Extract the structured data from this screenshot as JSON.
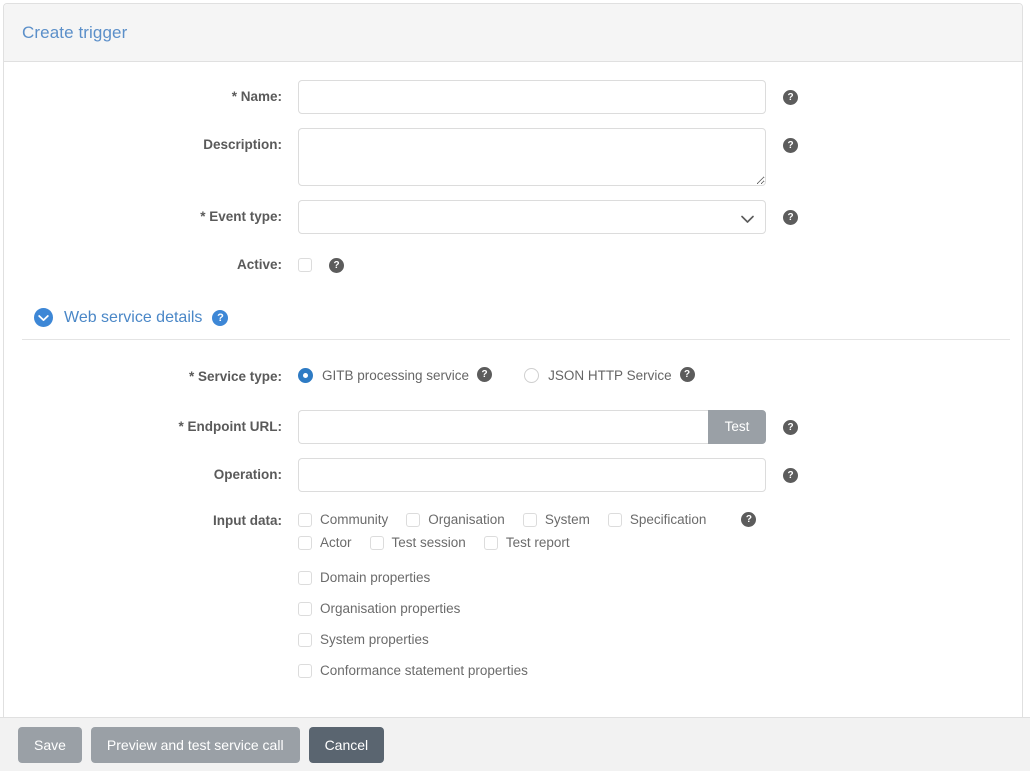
{
  "card": {
    "title": "Create trigger"
  },
  "form": {
    "name": {
      "label": "* Name:",
      "value": "",
      "placeholder": "",
      "help": "?"
    },
    "description": {
      "label": "Description:",
      "value": "",
      "placeholder": "",
      "help": "?"
    },
    "event_type": {
      "label": "* Event type:",
      "value": "",
      "help": "?"
    },
    "active": {
      "label": "Active:",
      "checked": false,
      "help": "?"
    }
  },
  "section": {
    "title": "Web service details",
    "expanded": true,
    "help": "?"
  },
  "service": {
    "service_type": {
      "label": "* Service type:",
      "options": [
        {
          "label": "GITB processing service",
          "selected": true,
          "help": "?"
        },
        {
          "label": "JSON HTTP Service",
          "selected": false,
          "help": "?"
        }
      ]
    },
    "endpoint_url": {
      "label": "* Endpoint URL:",
      "value": "",
      "placeholder": "",
      "test_button": "Test",
      "help": "?"
    },
    "operation": {
      "label": "Operation:",
      "value": "",
      "placeholder": "",
      "help": "?"
    },
    "input_data": {
      "label": "Input data:",
      "help": "?",
      "row1": [
        {
          "label": "Community",
          "checked": false
        },
        {
          "label": "Organisation",
          "checked": false
        },
        {
          "label": "System",
          "checked": false
        },
        {
          "label": "Specification",
          "checked": false
        }
      ],
      "row2": [
        {
          "label": "Actor",
          "checked": false
        },
        {
          "label": "Test session",
          "checked": false
        },
        {
          "label": "Test report",
          "checked": false
        }
      ],
      "stacked": [
        {
          "label": "Domain properties",
          "checked": false
        },
        {
          "label": "Organisation properties",
          "checked": false
        },
        {
          "label": "System properties",
          "checked": false
        },
        {
          "label": "Conformance statement properties",
          "checked": false
        }
      ]
    }
  },
  "footer": {
    "save": "Save",
    "preview": "Preview and test service call",
    "cancel": "Cancel"
  },
  "colors": {
    "title_blue": "#5b8fc9",
    "section_blue": "#4a87c7",
    "accent_blue": "#3d87d6",
    "radio_blue": "#2e7bc4",
    "button_grey": "#9aa0a6",
    "button_dark": "#5a6570",
    "help_grey": "#5c5c5c"
  }
}
